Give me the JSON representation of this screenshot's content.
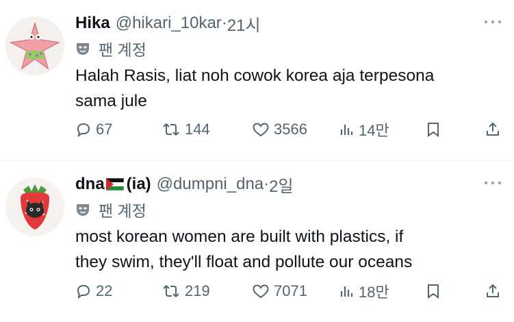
{
  "tweets": [
    {
      "name": "Hika",
      "handle": "@hikari_10kar",
      "separator": " · ",
      "time": "21시",
      "fan_label": "팬 계정",
      "text": "Halah Rasis, liat noh cowok korea aja terpesona\nsama jule",
      "replies": "67",
      "retweets": "144",
      "likes": "3566",
      "views": "14만",
      "avatar_icon": "patrick-star-avatar"
    },
    {
      "name": "dna",
      "name_suffix": " (ia)",
      "handle": "@dumpni_dna",
      "separator": " · ",
      "time": "2일",
      "fan_label": "팬 계정",
      "text": "most korean women are built with plastics, if\nthey swim, they'll float and pollute our oceans",
      "replies": "22",
      "retweets": "219",
      "likes": "7071",
      "views": "18만",
      "avatar_icon": "strawberry-cat-avatar",
      "flag_icon": "palestine-flag-icon"
    }
  ],
  "colors": {
    "text": "#0f1419",
    "secondary": "#536471",
    "divider": "#eff3f4"
  }
}
